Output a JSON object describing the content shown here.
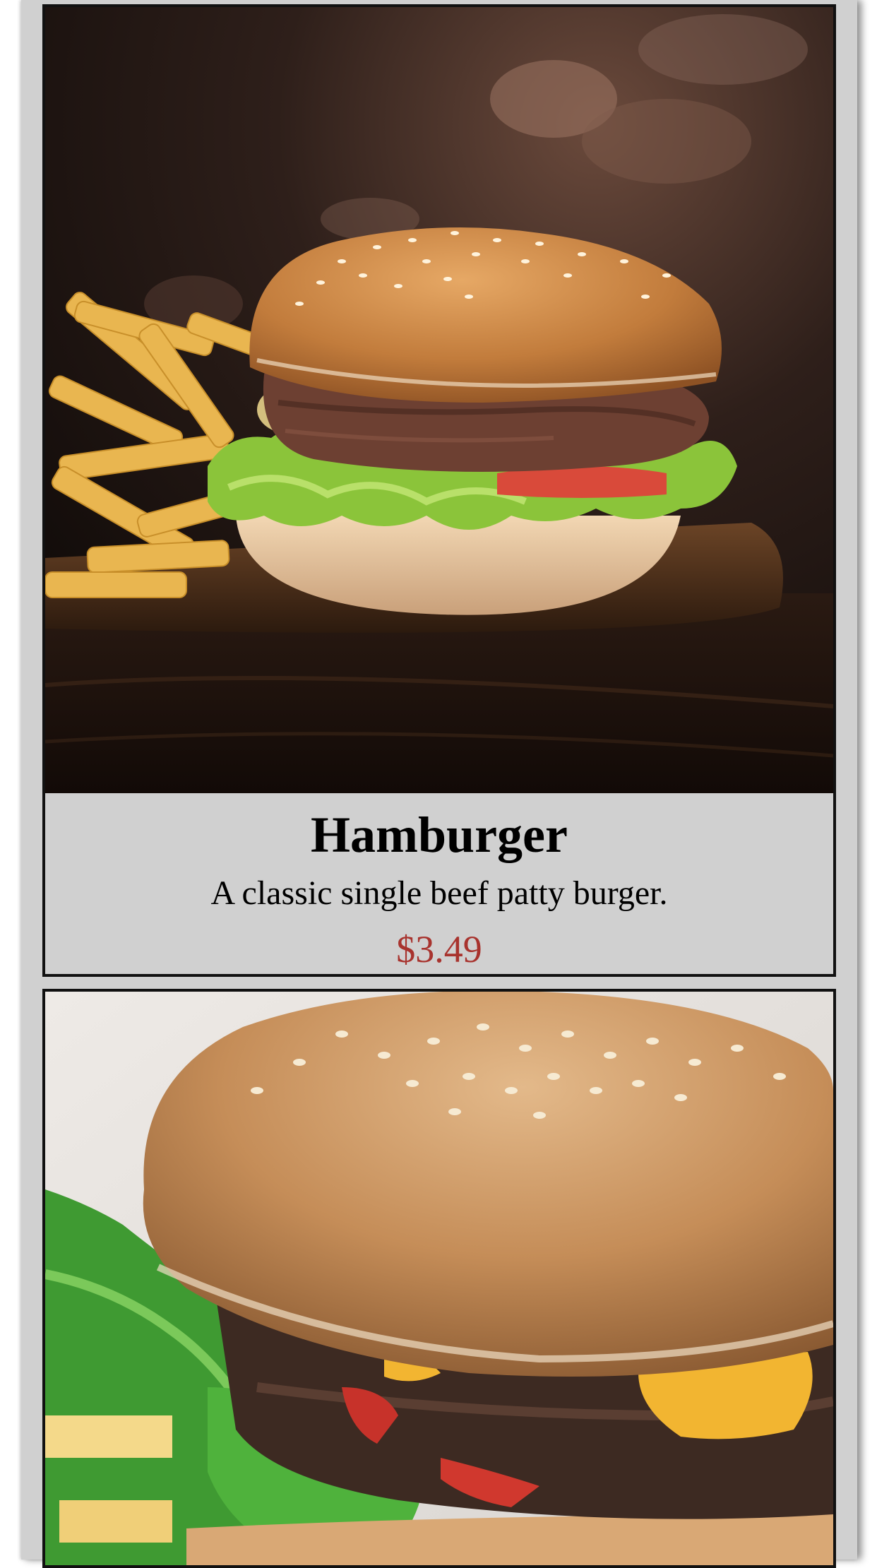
{
  "menu": {
    "items": [
      {
        "name": "Hamburger",
        "description": "A classic single beef patty burger.",
        "price": "$3.49",
        "image": "burger-with-fries-photo"
      },
      {
        "image": "cheeseburger-closeup-photo"
      }
    ]
  },
  "colors": {
    "page_background": "#d0d0d0",
    "card_border": "#111111",
    "price": "#a8332e"
  }
}
